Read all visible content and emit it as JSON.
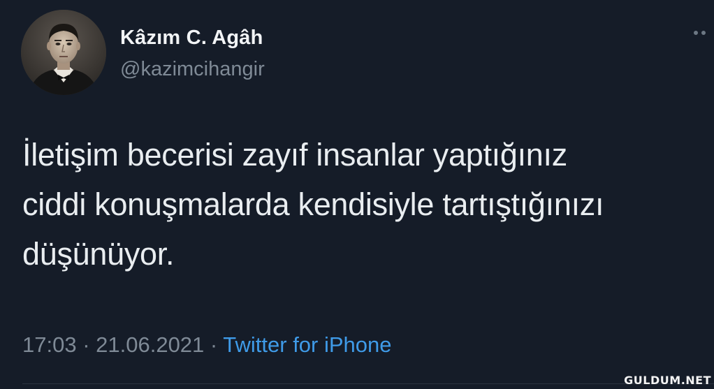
{
  "tweet": {
    "author_name": "Kâzım C. Agâh",
    "author_handle": "@kazimcihangir",
    "text_lines": [
      "İletişim becerisi zayıf insanlar yaptığınız",
      "ciddi konuşmalarda kendisiyle tartıştığınızı",
      "düşünüyor."
    ],
    "time": "17:03",
    "separator": " · ",
    "date": "21.06.2021",
    "source": "Twitter for iPhone",
    "more_icon": "more-horizontal-icon",
    "avatar": "profile-photo"
  },
  "watermark": "GULDUM.NET",
  "colors": {
    "background": "#151c28",
    "primary_text": "#e9edf0",
    "secondary_text": "#7f8a96",
    "link": "#3f9be8"
  }
}
